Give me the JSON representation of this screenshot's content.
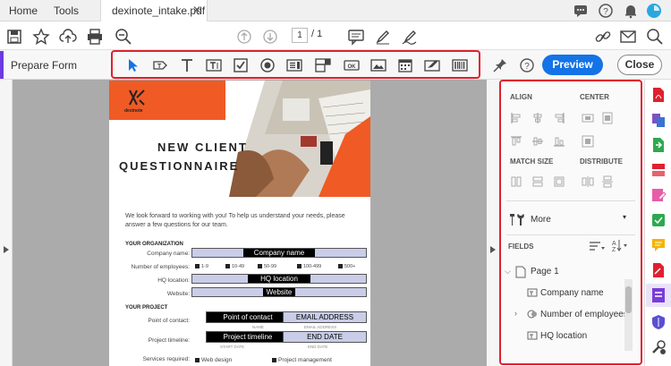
{
  "tabs": {
    "home": "Home",
    "tools": "Tools",
    "doc": "dexinote_intake.pdf"
  },
  "nav": {
    "page_current": "1",
    "page_total": "/  1"
  },
  "form_toolbar": {
    "label": "Prepare Form",
    "tools": [
      "select-icon",
      "add-text-icon",
      "text-icon",
      "text-field-icon",
      "checkbox-icon",
      "radio-icon",
      "list-box-icon",
      "dropdown-icon",
      "button-icon",
      "image-icon",
      "date-icon",
      "signature-icon",
      "barcode-icon"
    ],
    "preview": "Preview",
    "close": "Close"
  },
  "document": {
    "logo": "dexinote",
    "title1": "NEW CLIENT",
    "title2": "QUESTIONNAIRE",
    "intro": "We look forward to working with you! To help us understand your needs, please answer a few questions for our team.",
    "sec_org": "YOUR ORGANIZATION",
    "lbl_company": "Company name:",
    "fld_company": "Company name",
    "lbl_employees": "Number of employees:",
    "employee_opts": [
      "1-9",
      "10-49",
      "50-99",
      "100-499",
      "500+"
    ],
    "lbl_hq": "HQ location:",
    "fld_hq": "HQ location",
    "lbl_website": "Website:",
    "fld_website": "Website",
    "sec_project": "YOUR PROJECT",
    "lbl_contact": "Point of contact:",
    "fld_contact": "Point of contact",
    "fld_email": "EMAIL ADDRESS",
    "sub_name": "NAME",
    "sub_email": "EMAIL ADDRESS",
    "lbl_timeline": "Project timeline:",
    "fld_timeline": "Project timeline",
    "fld_end": "END DATE",
    "sub_start": "START DATE",
    "sub_end": "END DATE",
    "lbl_services": "Services required:",
    "svc1": "Web design",
    "svc2": "Project management"
  },
  "right_panel": {
    "align": "ALIGN",
    "center": "CENTER",
    "match_size": "MATCH SIZE",
    "distribute": "DISTRIBUTE",
    "more": "More",
    "fields": "FIELDS",
    "tree": [
      "Page 1",
      "Company name",
      "Number of employees",
      "HQ location"
    ]
  },
  "colors": {
    "accent": "#1473e6",
    "highlight": "#e0202e",
    "brand": "#f05a24",
    "mode": "#6d3ae0"
  }
}
